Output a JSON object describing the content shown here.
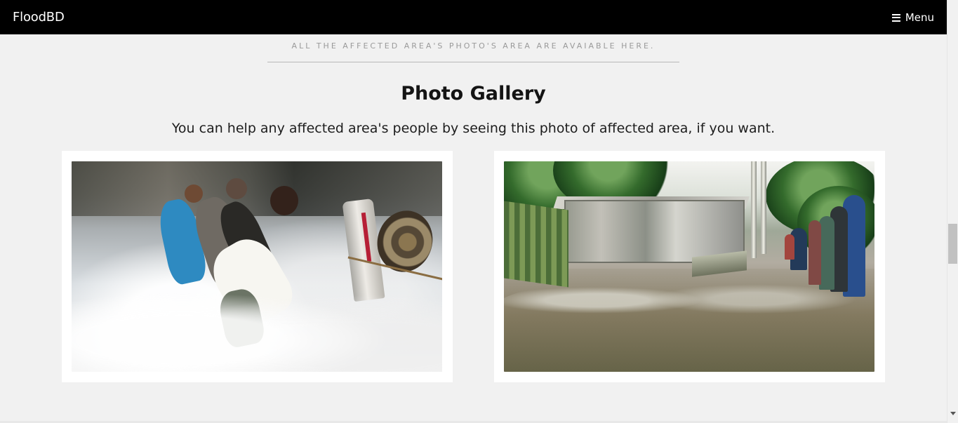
{
  "navbar": {
    "brand": "FloodBD",
    "menu_label": "Menu",
    "menu_icon": "hamburger-icon"
  },
  "section": {
    "kicker": "ALL THE AFFECTED AREA'S PHOTO'S AREA ARE AVAIABLE HERE.",
    "title": "Photo Gallery",
    "subtitle": "You can help any affected area's people by seeing this photo of affected area, if you want."
  },
  "gallery": {
    "photos": [
      {
        "name": "flood-rescue-photo"
      },
      {
        "name": "flooded-village-photo"
      }
    ]
  },
  "colors": {
    "navbar_background": "#000000",
    "page_background": "#f1f1f1",
    "card_background": "#ffffff",
    "text": "#141414",
    "muted_text": "#9a9a9a"
  },
  "scrollbar": {
    "visible": true
  }
}
